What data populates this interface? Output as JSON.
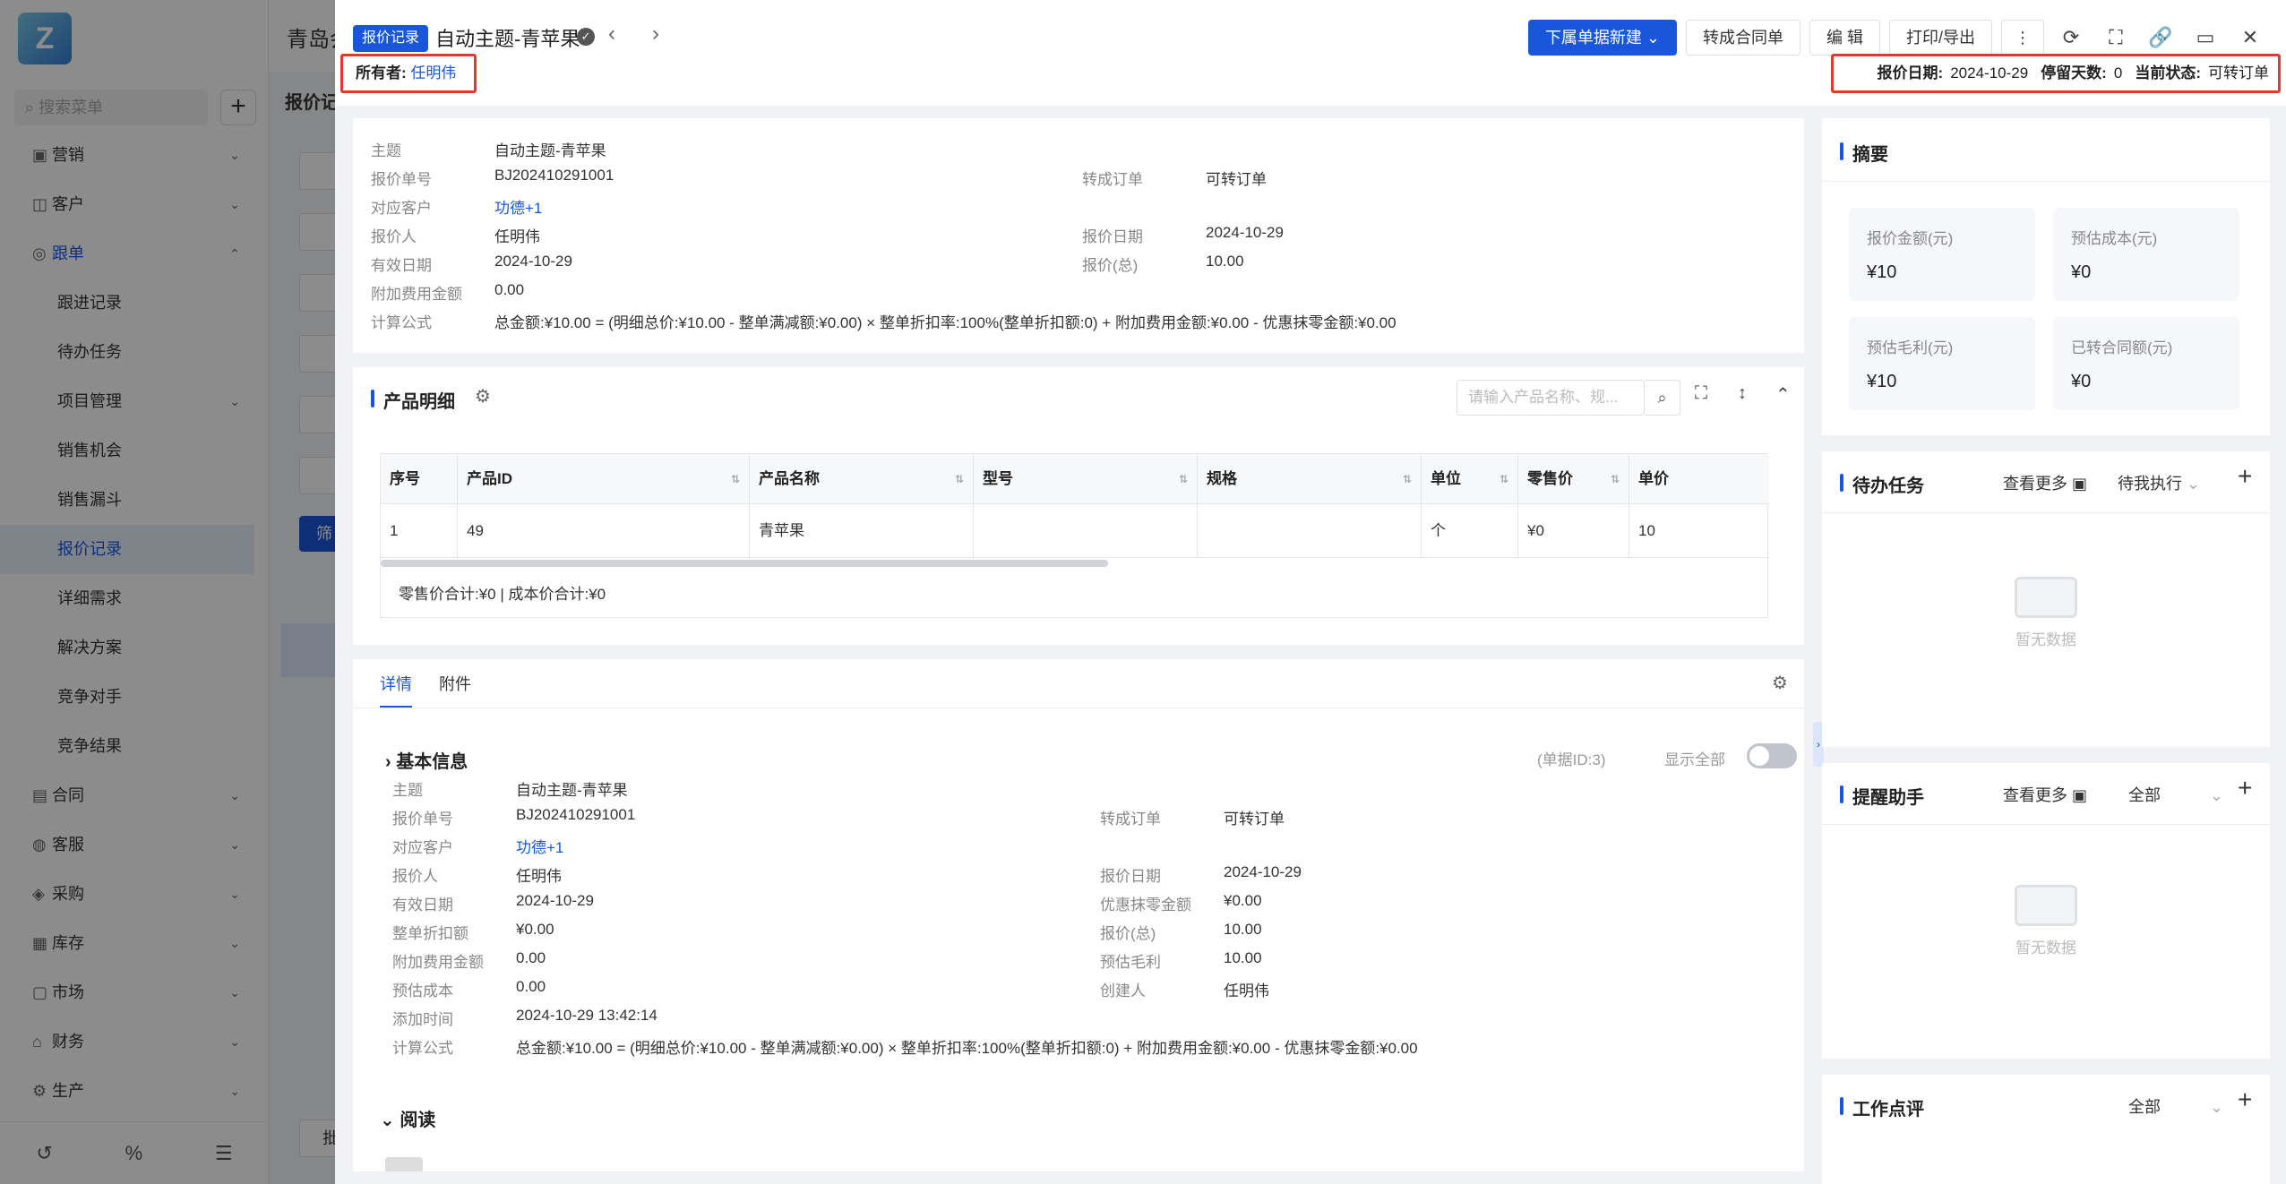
{
  "background": {
    "app_title": "青岛会",
    "sub_title": "报价记",
    "search_placeholder": "搜索菜单",
    "menu": [
      {
        "label": "营销",
        "icon": "gem-icon"
      },
      {
        "label": "客户",
        "icon": "user-icon"
      },
      {
        "label": "跟单",
        "icon": "track-icon"
      },
      {
        "label": "跟进记录",
        "icon": "doc-icon"
      },
      {
        "label": "待办任务",
        "icon": "pin-icon"
      },
      {
        "label": "项目管理",
        "icon": "project-icon"
      },
      {
        "label": "销售机会",
        "icon": "target-icon"
      },
      {
        "label": "销售漏斗",
        "icon": "funnel-icon"
      },
      {
        "label": "报价记录",
        "icon": "quote-icon"
      },
      {
        "label": "详细需求",
        "icon": "list-icon"
      },
      {
        "label": "解决方案",
        "icon": "bulb-icon"
      },
      {
        "label": "竞争对手",
        "icon": "rival-icon"
      },
      {
        "label": "竞争结果",
        "icon": "result-icon"
      },
      {
        "label": "合同",
        "icon": "contract-icon"
      },
      {
        "label": "客服",
        "icon": "service-icon"
      },
      {
        "label": "采购",
        "icon": "purchase-icon"
      },
      {
        "label": "库存",
        "icon": "stock-icon"
      },
      {
        "label": "市场",
        "icon": "market-icon"
      },
      {
        "label": "财务",
        "icon": "finance-icon"
      },
      {
        "label": "生产",
        "icon": "factory-icon"
      }
    ],
    "filter_btn": "筛",
    "batch_label": "批"
  },
  "header": {
    "tag": "报价记录",
    "title": "自动主题-青苹果",
    "owner_label": "所有者:",
    "owner_value": "任明伟",
    "buttons": {
      "new_sub": "下属单据新建",
      "to_contract": "转成合同单",
      "edit": "编 辑",
      "print": "打印/导出"
    },
    "status": {
      "date_label": "报价日期:",
      "date_value": "2024-10-29",
      "days_label": "停留天数:",
      "days_value": "0",
      "state_label": "当前状态:",
      "state_value": "可转订单"
    }
  },
  "info": {
    "subject_k": "主题",
    "subject_v": "自动主题-青苹果",
    "no_k": "报价单号",
    "no_v": "BJ202410291001",
    "convert_k": "转成订单",
    "convert_v": "可转订单",
    "customer_k": "对应客户",
    "customer_v": "功德+1",
    "quoter_k": "报价人",
    "quoter_v": "任明伟",
    "qdate_k": "报价日期",
    "qdate_v": "2024-10-29",
    "valid_k": "有效日期",
    "valid_v": "2024-10-29",
    "total_k": "报价(总)",
    "total_v": "10.00",
    "extra_k": "附加费用金额",
    "extra_v": "0.00",
    "formula_k": "计算公式",
    "formula_v": "总金额:¥10.00 = (明细总价:¥10.00 - 整单满减额:¥0.00) × 整单折扣率:100%(整单折扣额:0) + 附加费用金额:¥0.00 - 优惠抹零金额:¥0.00"
  },
  "products": {
    "title": "产品明细",
    "search_placeholder": "请输入产品名称、规...",
    "columns": [
      "序号",
      "产品ID",
      "产品名称",
      "型号",
      "规格",
      "单位",
      "零售价",
      "单价"
    ],
    "rows": [
      {
        "seq": "1",
        "id": "49",
        "name": "青苹果",
        "model": "",
        "spec": "",
        "unit": "个",
        "retail": "¥0",
        "price": "10"
      }
    ],
    "footer": "零售价合计:¥0 |   成本价合计:¥0"
  },
  "detail": {
    "tabs": [
      "详情",
      "附件"
    ],
    "basic_title": "基本信息",
    "doc_id": "(单据ID:3)",
    "show_all": "显示全部",
    "fields": {
      "subject_k": "主题",
      "subject_v": "自动主题-青苹果",
      "no_k": "报价单号",
      "no_v": "BJ202410291001",
      "convert_k": "转成订单",
      "convert_v": "可转订单",
      "customer_k": "对应客户",
      "customer_v": "功德+1",
      "quoter_k": "报价人",
      "quoter_v": "任明伟",
      "qdate_k": "报价日期",
      "qdate_v": "2024-10-29",
      "valid_k": "有效日期",
      "valid_v": "2024-10-29",
      "roundoff_k": "优惠抹零金额",
      "roundoff_v": "¥0.00",
      "discount_k": "整单折扣额",
      "discount_v": "¥0.00",
      "total_k": "报价(总)",
      "total_v": "10.00",
      "extra_k": "附加费用金额",
      "extra_v": "0.00",
      "profit_k": "预估毛利",
      "profit_v": "10.00",
      "cost_k": "预估成本",
      "cost_v": "0.00",
      "creator_k": "创建人",
      "creator_v": "任明伟",
      "added_k": "添加时间",
      "added_v": "2024-10-29 13:42:14",
      "formula_k": "计算公式",
      "formula_v": "总金额:¥10.00 = (明细总价:¥10.00 - 整单满减额:¥0.00) × 整单折扣率:100%(整单折扣额:0) + 附加费用金额:¥0.00 - 优惠抹零金额:¥0.00"
    },
    "read_title": "阅读"
  },
  "summary": {
    "title": "摘要",
    "stats": [
      {
        "label": "报价金额(元)",
        "value": "¥10"
      },
      {
        "label": "预估成本(元)",
        "value": "¥0"
      },
      {
        "label": "预估毛利(元)",
        "value": "¥10"
      },
      {
        "label": "已转合同额(元)",
        "value": "¥0"
      }
    ]
  },
  "todo": {
    "title": "待办任务",
    "more": "查看更多",
    "filter": "待我执行",
    "empty": "暂无数据"
  },
  "reminder": {
    "title": "提醒助手",
    "more": "查看更多",
    "filter": "全部",
    "empty": "暂无数据"
  },
  "review": {
    "title": "工作点评",
    "filter": "全部"
  },
  "colors": {
    "accent": "#1a56db",
    "highlight_border": "#e03a2e"
  }
}
